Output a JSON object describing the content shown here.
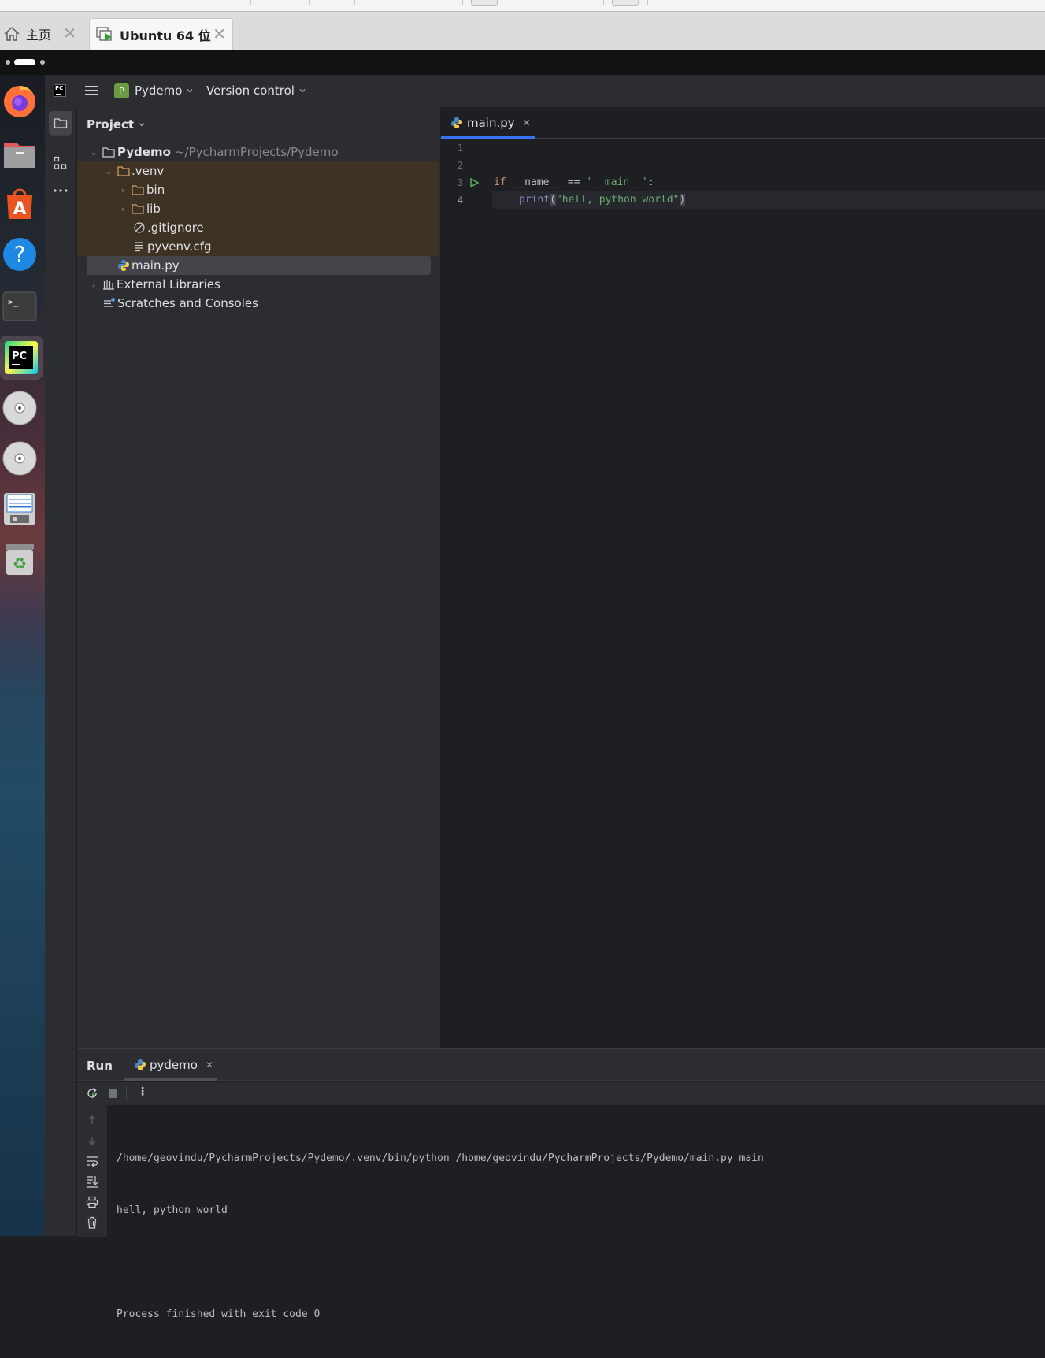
{
  "vm": {
    "tabs": [
      {
        "label": "主页",
        "icon": "home-icon"
      },
      {
        "label": "Ubuntu 64 位",
        "icon": "vm-running-icon"
      }
    ]
  },
  "dock": {
    "apps": [
      "firefox-icon",
      "files-icon",
      "app-center-icon",
      "help-icon",
      "terminal-icon",
      "pycharm-icon",
      "disc-icon",
      "disc-icon",
      "floppy-icon",
      "trash-icon"
    ]
  },
  "ide": {
    "logo": "PC",
    "project_badge": "P",
    "project_name": "Pydemo",
    "version_control": "Version control",
    "panel_title": "Project",
    "tree": [
      {
        "label": "Pydemo",
        "secondary": "~/PycharmProjects/Pydemo"
      },
      {
        "label": ".venv"
      },
      {
        "label": "bin"
      },
      {
        "label": "lib"
      },
      {
        "label": ".gitignore"
      },
      {
        "label": "pyvenv.cfg"
      },
      {
        "label": "main.py"
      },
      {
        "label": "External Libraries"
      },
      {
        "label": "Scratches and Consoles"
      }
    ],
    "editor": {
      "tab": "main.py",
      "line_numbers": [
        "1",
        "2",
        "3",
        "4"
      ],
      "code": {
        "l3_kw": "if",
        "l3_name": " __name__ == ",
        "l3_str": "'__main__'",
        "l3_colon": ":",
        "l4_fn": "print",
        "l4_open": "(",
        "l4_str": "\"hell, python world\"",
        "l4_close": ")"
      }
    },
    "run": {
      "title": "Run",
      "tab": "pydemo",
      "output": [
        "/home/geovindu/PycharmProjects/Pydemo/.venv/bin/python /home/geovindu/PycharmProjects/Pydemo/main.py main",
        "hell, python world",
        "",
        "Process finished with exit code 0"
      ]
    }
  },
  "colors": {
    "ide_bg": "#2b2d30",
    "editor_bg": "#1e1f22",
    "accent": "#3574f0",
    "venv_highlight": "#3d3223",
    "keyword": "#cf8e6d",
    "string": "#6aab73",
    "builtin": "#8888c6"
  }
}
